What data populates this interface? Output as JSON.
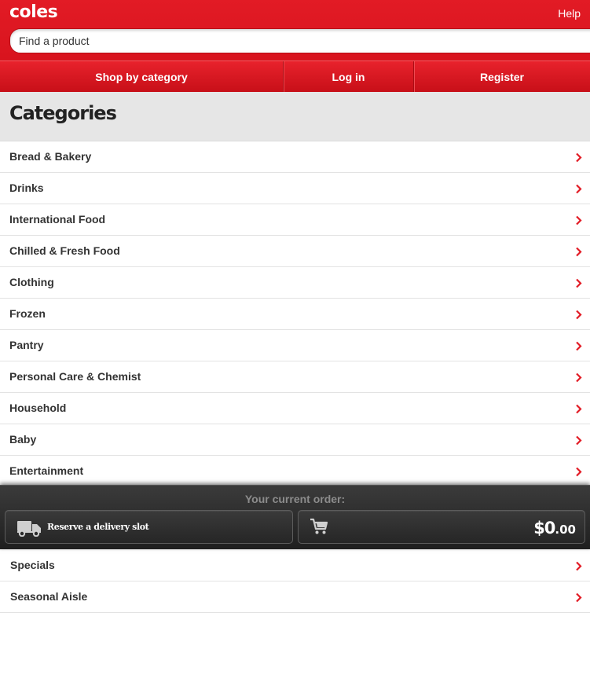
{
  "header": {
    "logo": "coles",
    "help_label": "Help",
    "search_placeholder": "Find a product",
    "brand_color": "#e21b25"
  },
  "nav": {
    "shop_by_category": "Shop by category",
    "log_in": "Log in",
    "register": "Register"
  },
  "categories": {
    "title": "Categories",
    "items": [
      {
        "label": "Bread & Bakery"
      },
      {
        "label": "Drinks"
      },
      {
        "label": "International Food"
      },
      {
        "label": "Chilled & Fresh Food"
      },
      {
        "label": "Clothing"
      },
      {
        "label": "Frozen"
      },
      {
        "label": "Pantry"
      },
      {
        "label": "Personal Care & Chemist"
      },
      {
        "label": "Household"
      },
      {
        "label": "Baby"
      },
      {
        "label": "Entertainment"
      }
    ],
    "more_items": [
      {
        "label": "Specials"
      },
      {
        "label": "Seasonal Aisle"
      }
    ],
    "chevron_icon": "chevron-right-icon",
    "chevron_color": "#e21b25"
  },
  "order": {
    "title": "Your current order:",
    "reserve_label": "Reserve a delivery slot",
    "truck_icon": "truck-icon",
    "cart_icon": "cart-icon",
    "total_dollars": "$0",
    "total_cents": ".00"
  }
}
